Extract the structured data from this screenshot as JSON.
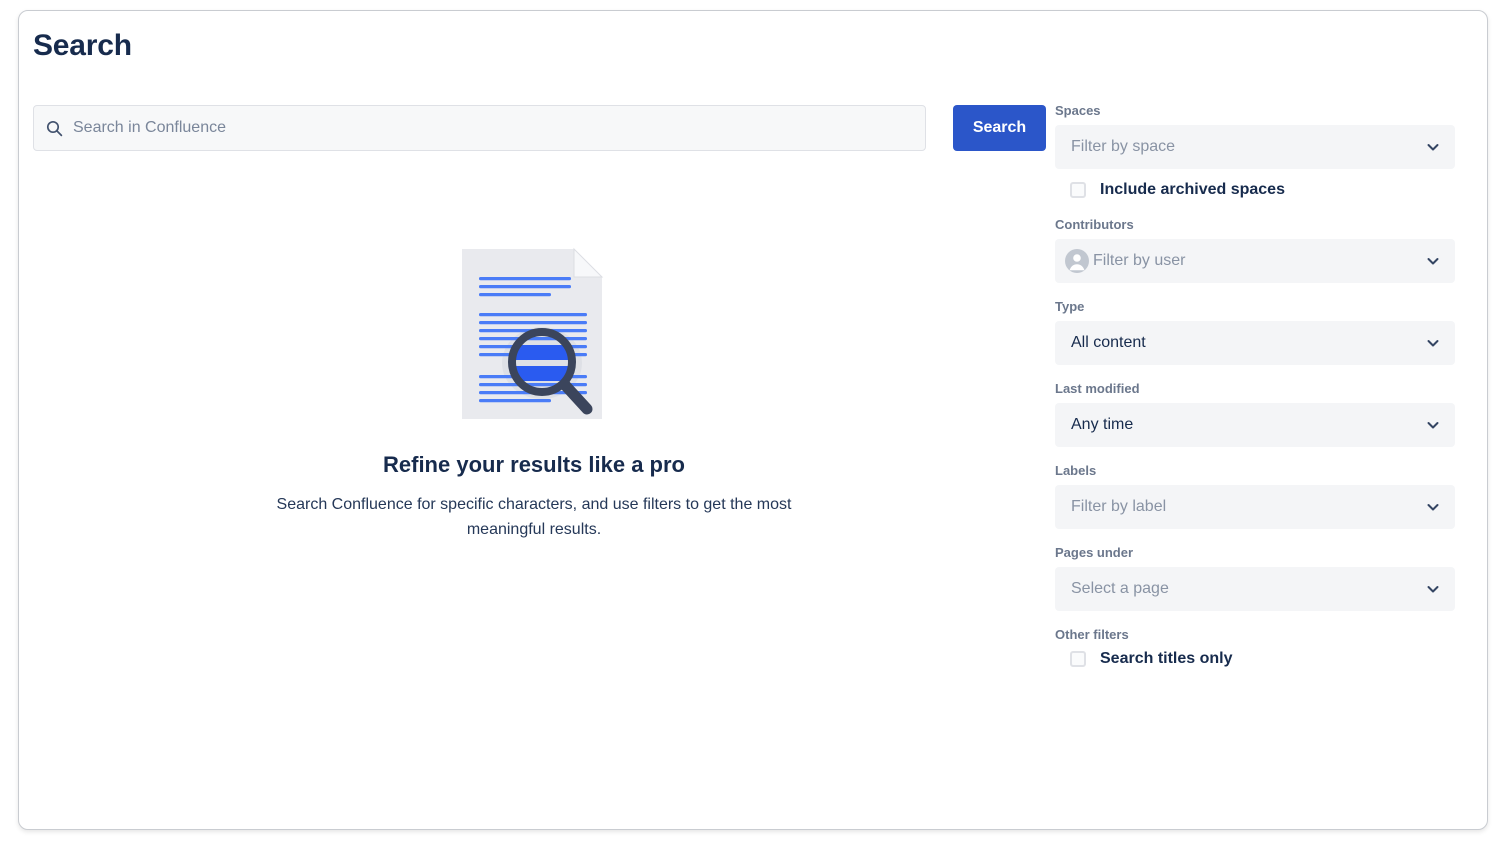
{
  "page": {
    "title": "Search"
  },
  "search": {
    "placeholder": "Search in Confluence",
    "value": "",
    "button_label": "Search",
    "icon": "search-icon",
    "button_color": "#2b56c9"
  },
  "empty_state": {
    "illustration": "document-magnifier-illustration",
    "heading": "Refine your results like a pro",
    "description": "Search Confluence for specific characters, and use filters to get the most meaningful results."
  },
  "filters": {
    "spaces": {
      "label": "Spaces",
      "value": "Filter by space",
      "is_placeholder": true,
      "chevron": "chevron-down-icon"
    },
    "include_archived": {
      "label": "Include archived spaces",
      "checked": false
    },
    "contributors": {
      "label": "Contributors",
      "value": "Filter by user",
      "is_placeholder": true,
      "avatar": "user-avatar-icon",
      "chevron": "chevron-down-icon"
    },
    "type": {
      "label": "Type",
      "value": "All content",
      "is_placeholder": false,
      "chevron": "chevron-down-icon"
    },
    "last_modified": {
      "label": "Last modified",
      "value": "Any time",
      "is_placeholder": false,
      "chevron": "chevron-down-icon"
    },
    "labels": {
      "label": "Labels",
      "value": "Filter by label",
      "is_placeholder": true,
      "chevron": "chevron-down-icon"
    },
    "pages_under": {
      "label": "Pages under",
      "value": "Select a page",
      "is_placeholder": true,
      "chevron": "chevron-down-icon"
    },
    "other": {
      "label": "Other filters",
      "search_titles_only": {
        "label": "Search titles only",
        "checked": false
      }
    }
  },
  "colors": {
    "text_primary": "#172b4d",
    "text_subtle": "#6b778c",
    "placeholder": "#8993a4",
    "field_bg": "#f4f5f7",
    "accent_blue": "#2b56c9",
    "illustration_blue": "#356cf5"
  }
}
